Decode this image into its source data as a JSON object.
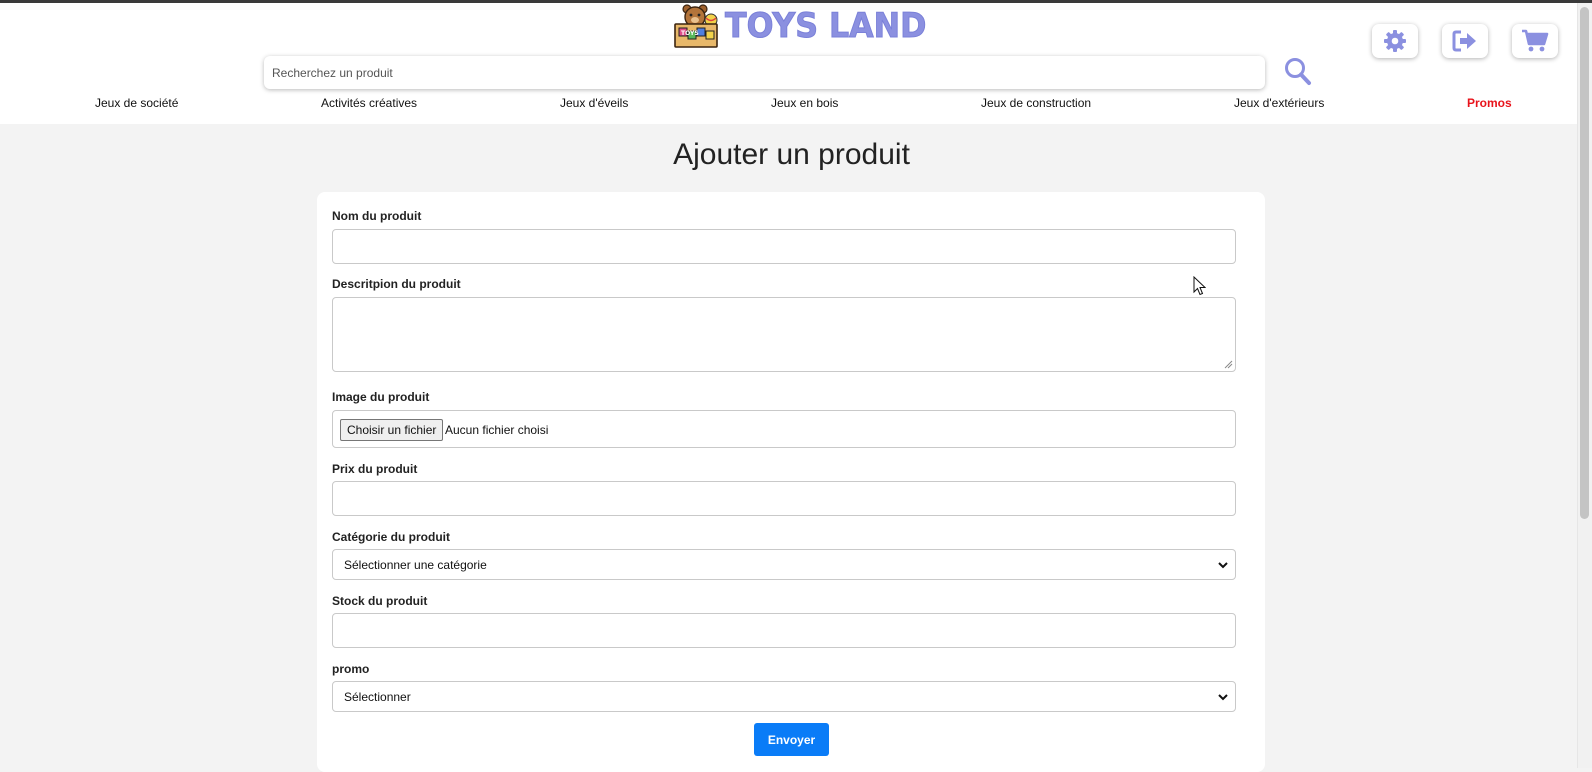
{
  "brand": {
    "name": "TOYS LAND",
    "logo_box_text": "TOYS",
    "color": "#8b90e0"
  },
  "search": {
    "placeholder": "Recherchez un produit",
    "icon": "search-icon"
  },
  "header_actions": [
    {
      "icon": "gear-icon",
      "label": "settings"
    },
    {
      "icon": "logout-icon",
      "label": "logout"
    },
    {
      "icon": "cart-icon",
      "label": "cart"
    }
  ],
  "nav": {
    "items": [
      {
        "label": "Jeux de société"
      },
      {
        "label": "Activités créatives"
      },
      {
        "label": "Jeux d'éveils"
      },
      {
        "label": "Jeux en bois"
      },
      {
        "label": "Jeux de construction"
      },
      {
        "label": "Jeux d'extérieurs"
      },
      {
        "label": "Promos"
      }
    ],
    "promo_color": "#e8131b"
  },
  "page": {
    "title": "Ajouter un produit"
  },
  "form": {
    "name_label": "Nom du produit",
    "name_value": "",
    "description_label": "Descritpion du produit",
    "description_value": "",
    "image_label": "Image du produit",
    "file_button": "Choisir un fichier",
    "file_status": "Aucun fichier choisi",
    "price_label": "Prix du produit",
    "price_value": "",
    "category_label": "Catégorie du produit",
    "category_selected": "Sélectionner une catégorie",
    "stock_label": "Stock du produit",
    "stock_value": "",
    "promo_label": "promo",
    "promo_selected": "Sélectionner",
    "submit_label": "Envoyer",
    "submit_color": "#0a7cf7"
  }
}
